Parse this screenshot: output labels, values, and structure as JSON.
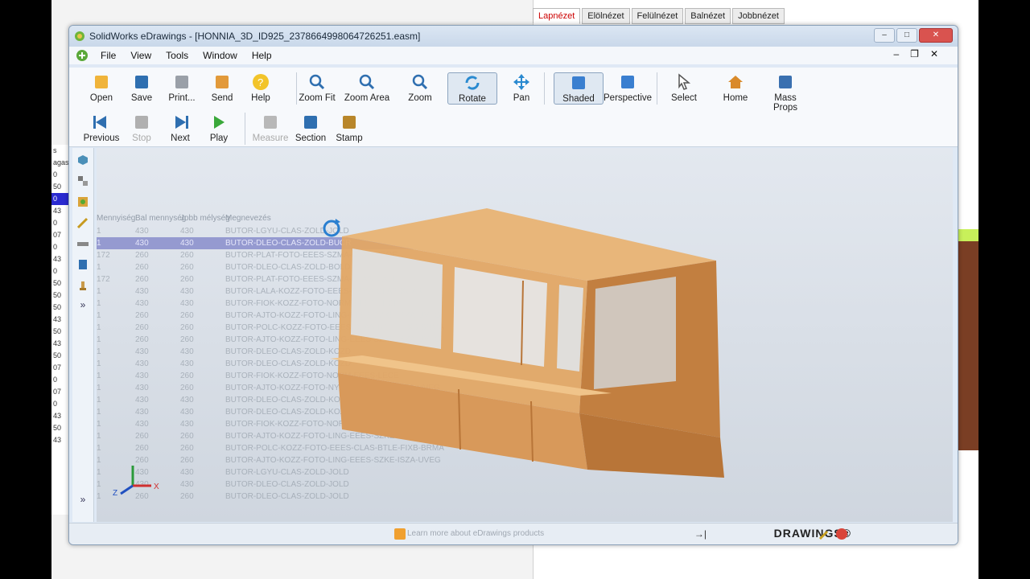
{
  "desktop": {
    "view_tabs": [
      "Lapnézet",
      "Elölnézet",
      "Felülnézet",
      "Balnézet",
      "Jobbnézet"
    ],
    "left_pane_rows": [
      "s",
      "agas",
      "0",
      "50",
      "0",
      "43",
      "0",
      "07",
      "0",
      "43",
      "0",
      "50",
      "50",
      "50",
      "43",
      "50",
      "43",
      "50",
      "07",
      "0",
      "07",
      "0",
      "43",
      "50",
      "43"
    ],
    "left_pane_selected": 4
  },
  "window": {
    "title": "SolidWorks eDrawings - [HONNIA_3D_ID925_2378664998064726251.easm]",
    "controls": {
      "minimize": "–",
      "restore": "□",
      "close": "✕"
    }
  },
  "menu": {
    "items": [
      "File",
      "View",
      "Tools",
      "Window",
      "Help"
    ],
    "mdi": {
      "minimize": "–",
      "restore": "❐",
      "close": "✕"
    }
  },
  "toolbar": {
    "row1": [
      {
        "label": "Open",
        "icon": "folder-icon"
      },
      {
        "label": "Save",
        "icon": "save-icon"
      },
      {
        "label": "Print...",
        "icon": "print-icon"
      },
      {
        "label": "Send",
        "icon": "send-icon"
      },
      {
        "label": "Help",
        "icon": "help-icon"
      },
      {
        "label": "Zoom Fit",
        "icon": "zoom-fit-icon"
      },
      {
        "label": "Zoom Area",
        "icon": "zoom-area-icon"
      },
      {
        "label": "Zoom",
        "icon": "zoom-icon"
      },
      {
        "label": "Rotate",
        "icon": "rotate-icon"
      },
      {
        "label": "Pan",
        "icon": "pan-icon"
      },
      {
        "label": "Shaded",
        "icon": "shaded-icon"
      },
      {
        "label": "Perspective",
        "icon": "perspective-icon"
      },
      {
        "label": "Select",
        "icon": "select-icon"
      },
      {
        "label": "Home",
        "icon": "home-icon"
      },
      {
        "label": "Mass Props",
        "icon": "mass-props-icon"
      }
    ],
    "row2": [
      {
        "label": "Previous",
        "icon": "previous-icon"
      },
      {
        "label": "Stop",
        "icon": "stop-icon"
      },
      {
        "label": "Next",
        "icon": "next-icon"
      },
      {
        "label": "Play",
        "icon": "play-icon"
      },
      {
        "label": "Measure",
        "icon": "measure-icon"
      },
      {
        "label": "Section",
        "icon": "section-icon"
      },
      {
        "label": "Stamp",
        "icon": "stamp-icon"
      }
    ]
  },
  "ghost_table": {
    "headers": [
      "Mennyiség",
      "Bal mennység",
      "Jobb mélység",
      "Megnevezés"
    ],
    "rows": [
      [
        "1",
        "430",
        "430",
        "BUTOR-LGYU-CLAS-ZOLD-JOLD"
      ],
      [
        "1",
        "430",
        "430",
        "BUTOR-DLEO-CLAS-ZOLD-BUCR"
      ],
      [
        "172",
        "260",
        "260",
        "BUTOR-PLAT-FOTO-EEES-SZMA-CLAS-PFOE"
      ],
      [
        "1",
        "260",
        "260",
        "BUTOR-DLEO-CLAS-ZOLD-BOLD"
      ],
      [
        "172",
        "260",
        "260",
        "BUTOR-PLAT-FOTO-EEES-SZMA-CLAS-MALL"
      ],
      [
        "1",
        "430",
        "430",
        "BUTOR-LALA-KOZZ-FOTO-EEES-SZMA-CLAS-XUAR"
      ],
      [
        "1",
        "430",
        "430",
        "BUTOR-FIOK-KOZZ-FOTO-NORM-EEES-LECE"
      ],
      [
        "1",
        "260",
        "260",
        "BUTOR-AJTO-KOZZ-FOTO-LING-EEES-SZKE-ISZA-UVEG"
      ],
      [
        "1",
        "260",
        "260",
        "BUTOR-POLC-KOZZ-FOTO-EEES-CLAS-BTLE-FIXB-BRMA"
      ],
      [
        "1",
        "260",
        "260",
        "BUTOR-AJTO-KOZZ-FOTO-LING-EEES-SZKE-ISZA-UVEG"
      ],
      [
        "1",
        "430",
        "430",
        "BUTOR-DLEO-CLAS-ZOLD-KOZD"
      ],
      [
        "1",
        "430",
        "430",
        "BUTOR-DLEO-CLAS-ZOLD-KOZD"
      ],
      [
        "1",
        "430",
        "260",
        "BUTOR-FIOK-KOZZ-FOTO-NORM-EEES-LECE"
      ],
      [
        "1",
        "430",
        "260",
        "BUTOR-AJTO-KOZZ-FOTO-NYIL-EEES-SZKE-ISZA-UVEG"
      ],
      [
        "1",
        "430",
        "430",
        "BUTOR-DLEO-CLAS-ZOLD-KOZD"
      ],
      [
        "1",
        "430",
        "430",
        "BUTOR-DLEO-CLAS-ZOLD-KOZD"
      ],
      [
        "1",
        "430",
        "430",
        "BUTOR-FIOK-KOZZ-FOTO-NORM-EEES-LECE"
      ],
      [
        "1",
        "260",
        "260",
        "BUTOR-AJTO-KOZZ-FOTO-LING-EEES-SZKE-ISZA-UVEG"
      ],
      [
        "1",
        "260",
        "260",
        "BUTOR-POLC-KOZZ-FOTO-EEES-CLAS-BTLE-FIXB-BRMA"
      ],
      [
        "1",
        "260",
        "260",
        "BUTOR-AJTO-KOZZ-FOTO-LING-EEES-SZKE-ISZA-UVEG"
      ],
      [
        "1",
        "430",
        "430",
        "BUTOR-LGYU-CLAS-ZOLD-JOLD"
      ],
      [
        "1",
        "430",
        "430",
        "BUTOR-DLEO-CLAS-ZOLD-JOLD"
      ],
      [
        "1",
        "260",
        "260",
        "BUTOR-DLEO-CLAS-ZOLD-JOLD"
      ]
    ],
    "highlighted_row": 1
  },
  "status": {
    "message": "Learn more about eDrawings products",
    "brand": "DRAWINGS®"
  },
  "colors": {
    "accent": "#2a5fb8",
    "wood": "#e1a765",
    "wood_dark": "#c27f40",
    "selection": "#7d82c8"
  }
}
